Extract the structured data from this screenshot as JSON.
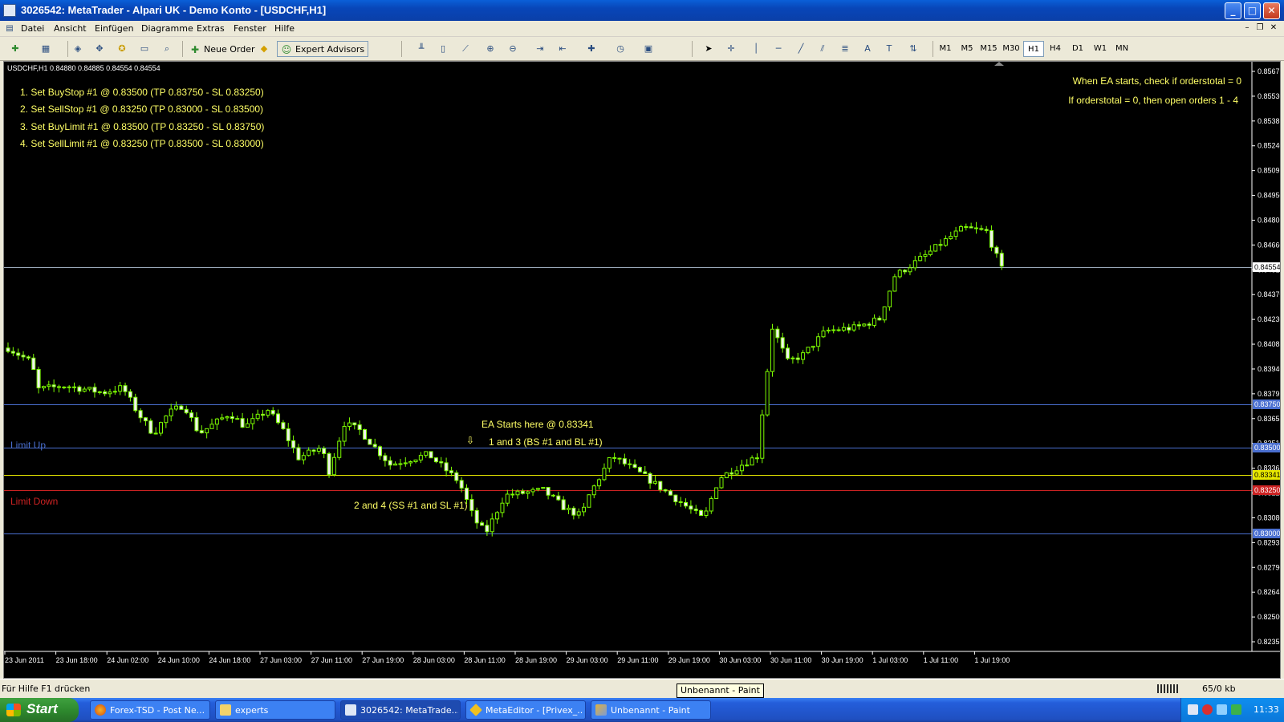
{
  "window": {
    "title": "3026542: MetaTrader - Alpari UK - Demo Konto - [USDCHF,H1]",
    "buttons": {
      "minimize": "_",
      "maximize": "□",
      "close": "✕"
    }
  },
  "menu": {
    "items": [
      "Datei",
      "Ansicht",
      "Einfügen",
      "Diagramme",
      "Extras",
      "Fenster",
      "Hilfe"
    ],
    "mdi_min": "–",
    "mdi_restore": "❐",
    "mdi_close": "✕"
  },
  "toolbar": {
    "neue_order": "Neue Order",
    "expert_advisors": "Expert Advisors",
    "timeframes": [
      "M1",
      "M5",
      "M15",
      "M30",
      "H1",
      "H4",
      "D1",
      "W1",
      "MN"
    ],
    "active_timeframe": "H1",
    "tool_text_a": "A",
    "tool_text_t": "T"
  },
  "chart": {
    "symbol_header": "USDCHF,H1  0.84880 0.84885 0.84554 0.84554",
    "colors": {
      "background": "#000000",
      "candle": "#7cfc00",
      "text_annotation": "#ffff66",
      "limit_up": "#4a6fd0",
      "limit_down": "#cc2222"
    },
    "instructions": [
      "1. Set BuyStop #1 @ 0.83500 (TP 0.83750 - SL 0.83250)",
      "2. Set SellStop #1 @ 0.83250 (TP 0.83000 - SL 0.83500)",
      "3. Set BuyLimit #1 @ 0.83500 (TP 0.83250 - SL 0.83750)",
      "4. Set SellLimit #1 @ 0.83250 (TP 0.83500 - SL 0.83000)"
    ],
    "notes": [
      "When EA starts, check if orderstotal = 0",
      "If orderstotal = 0, then open orders 1 - 4"
    ],
    "ea_start": "EA Starts here @ 0.83341",
    "ea_arrow": "⇩",
    "orders_13": "1 and 3 (BS #1 and BL #1)",
    "orders_24": "2 and 4 (SS #1 and SL #1)",
    "limit_up_label": "Limit Up",
    "limit_down_label": "Limit Down",
    "y_ticks": [
      "0.85675",
      "0.85530",
      "0.85385",
      "0.85240",
      "0.85095",
      "0.84950",
      "0.84805",
      "0.84660",
      "0.84515",
      "0.84370",
      "0.84230",
      "0.84085",
      "0.83940",
      "0.83795",
      "0.83655",
      "0.83510",
      "0.83365",
      "0.83225",
      "0.83080",
      "0.82935",
      "0.82790",
      "0.82645",
      "0.82500",
      "0.82355"
    ],
    "x_ticks": [
      "23 Jun 2011",
      "23 Jun 18:00",
      "24 Jun 02:00",
      "24 Jun 10:00",
      "24 Jun 18:00",
      "27 Jun 03:00",
      "27 Jun 11:00",
      "27 Jun 19:00",
      "28 Jun 03:00",
      "28 Jun 11:00",
      "28 Jun 19:00",
      "29 Jun 03:00",
      "29 Jun 11:00",
      "29 Jun 19:00",
      "30 Jun 03:00",
      "30 Jun 11:00",
      "30 Jun 19:00",
      "1 Jul 03:00",
      "1 Jul 11:00",
      "1 Jul 19:00"
    ],
    "price_lines": [
      {
        "price": 0.84554,
        "label": "0.84554",
        "color": "#9aa8b8",
        "tag_bg": "#ffffff",
        "tag_fg": "#000000"
      },
      {
        "price": 0.8375,
        "label": "0.83750",
        "color": "#4a6fd0",
        "tag_bg": "#4a6fd0",
        "tag_fg": "#ffffff"
      },
      {
        "price": 0.835,
        "label": "0.83500",
        "color": "#4a6fd0",
        "tag_bg": "#4a6fd0",
        "tag_fg": "#ffffff"
      },
      {
        "price": 0.83341,
        "label": "0.83341",
        "color": "#e8e800",
        "tag_bg": "#e8e800",
        "tag_fg": "#000000"
      },
      {
        "price": 0.8325,
        "label": "0.83250",
        "color": "#cc2222",
        "tag_bg": "#cc2222",
        "tag_fg": "#ffffff"
      },
      {
        "price": 0.83,
        "label": "0.83000",
        "color": "#4a6fd0",
        "tag_bg": "#4a6fd0",
        "tag_fg": "#ffffff"
      }
    ]
  },
  "chart_data": {
    "type": "candlestick",
    "ylim": [
      0.8231,
      0.8575
    ],
    "candle_count": 196,
    "waypoints": [
      [
        0,
        0.8408
      ],
      [
        6,
        0.84
      ],
      [
        8,
        0.8384
      ],
      [
        15,
        0.8386
      ],
      [
        25,
        0.8382
      ],
      [
        30,
        0.8385
      ],
      [
        34,
        0.837
      ],
      [
        38,
        0.8358
      ],
      [
        42,
        0.837
      ],
      [
        46,
        0.8375
      ],
      [
        50,
        0.8358
      ],
      [
        58,
        0.837
      ],
      [
        62,
        0.8362
      ],
      [
        68,
        0.8372
      ],
      [
        72,
        0.836
      ],
      [
        76,
        0.8344
      ],
      [
        82,
        0.835
      ],
      [
        84,
        0.8336
      ],
      [
        88,
        0.8364
      ],
      [
        92,
        0.836
      ],
      [
        100,
        0.834
      ],
      [
        110,
        0.8346
      ],
      [
        118,
        0.833
      ],
      [
        122,
        0.8308
      ],
      [
        125,
        0.83
      ],
      [
        130,
        0.8322
      ],
      [
        140,
        0.8325
      ],
      [
        146,
        0.8314
      ],
      [
        150,
        0.831
      ],
      [
        152,
        0.8322
      ],
      [
        158,
        0.8345
      ],
      [
        166,
        0.8334
      ],
      [
        176,
        0.8318
      ],
      [
        182,
        0.8308
      ],
      [
        186,
        0.8332
      ],
      [
        192,
        0.834
      ],
      [
        196,
        0.8345
      ],
      [
        200,
        0.842
      ],
      [
        204,
        0.84
      ],
      [
        208,
        0.8404
      ],
      [
        214,
        0.8418
      ],
      [
        222,
        0.842
      ],
      [
        228,
        0.8425
      ],
      [
        232,
        0.845
      ],
      [
        240,
        0.8462
      ],
      [
        246,
        0.8472
      ],
      [
        250,
        0.8478
      ],
      [
        256,
        0.8476
      ],
      [
        260,
        0.8454
      ]
    ],
    "series": [
      {
        "name": "",
        "values": []
      }
    ]
  },
  "status": {
    "help": "Für Hilfe F1 drücken",
    "traffic": "65/0 kb",
    "tooltip": "Unbenannt - Paint"
  },
  "taskbar": {
    "start": "Start",
    "tasks": [
      "Forex-TSD - Post Ne...",
      "experts",
      "3026542: MetaTrade...",
      "MetaEditor - [Privex_...",
      "Unbenannt - Paint"
    ],
    "active_task": 2,
    "clock": "11:33"
  }
}
